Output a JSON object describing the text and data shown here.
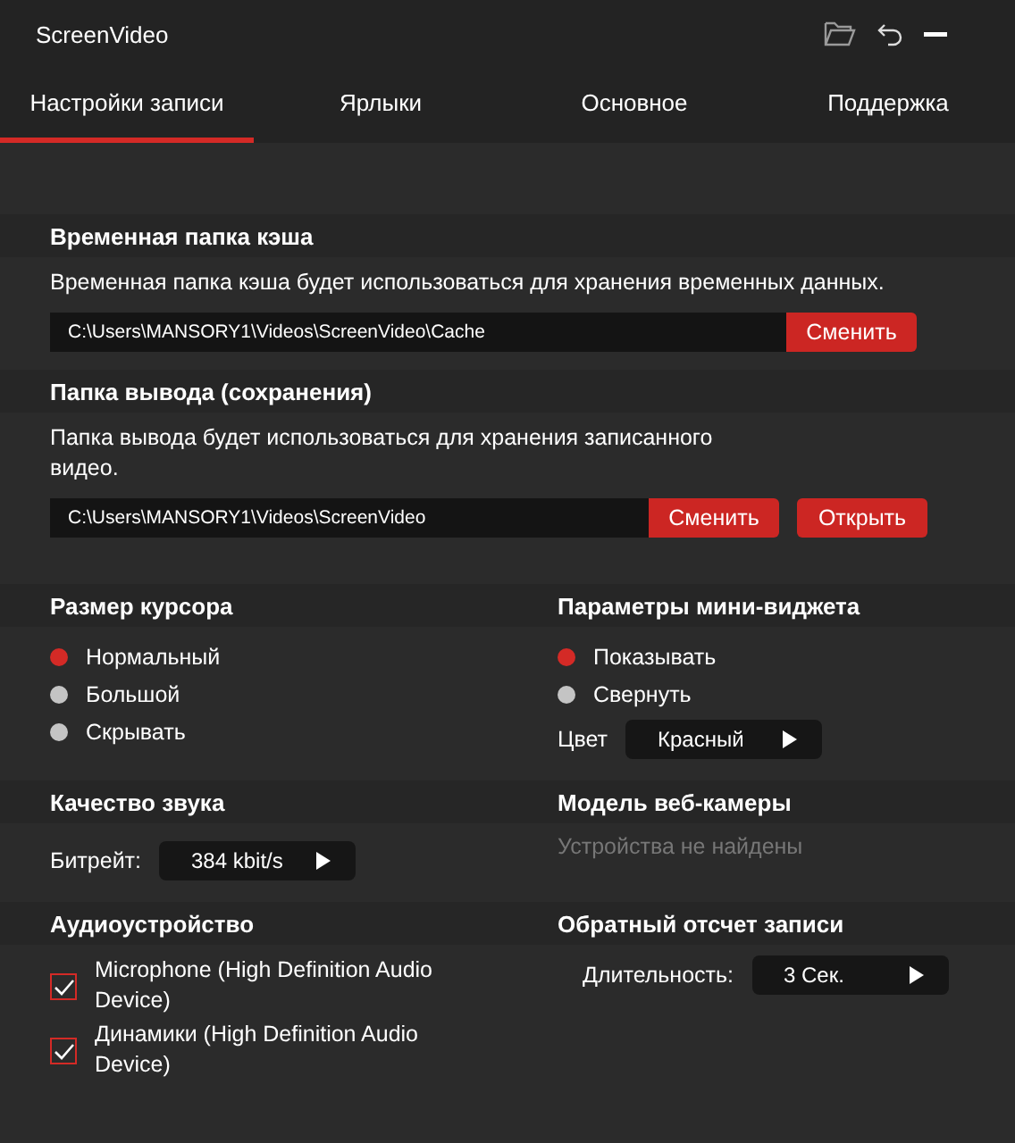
{
  "app_title": "ScreenVideo",
  "tabs": [
    {
      "label": "Настройки записи",
      "selected": true
    },
    {
      "label": "Ярлыки",
      "selected": false
    },
    {
      "label": "Основное",
      "selected": false
    },
    {
      "label": "Поддержка",
      "selected": false
    }
  ],
  "cache": {
    "title": "Временная папка кэша",
    "description": "Временная папка кэша будет использоваться для хранения временных данных.",
    "path": "C:\\Users\\MANSORY1\\Videos\\ScreenVideo\\Cache",
    "change_button": "Сменить"
  },
  "output": {
    "title": "Папка вывода (сохранения)",
    "description": "Папка вывода будет использоваться для хранения записанного видео.",
    "path": "C:\\Users\\MANSORY1\\Videos\\ScreenVideo",
    "change_button": "Сменить",
    "open_button": "Открыть"
  },
  "cursor_size": {
    "title": "Размер курсора",
    "options": [
      {
        "label": "Нормальный",
        "selected": true
      },
      {
        "label": "Большой",
        "selected": false
      },
      {
        "label": "Скрывать",
        "selected": false
      }
    ]
  },
  "mini_widget": {
    "title": "Параметры мини-виджета",
    "options": [
      {
        "label": "Показывать",
        "selected": true
      },
      {
        "label": "Свернуть",
        "selected": false
      }
    ],
    "color_label": "Цвет",
    "color_value": "Красный"
  },
  "audio_quality": {
    "title": "Качество звука",
    "bitrate_label": "Битрейт:",
    "bitrate_value": "384 kbit/s"
  },
  "webcam": {
    "title": "Модель веб-камеры",
    "message": "Устройства не найдены"
  },
  "audio_devices": {
    "title": "Аудиоустройство",
    "devices": [
      {
        "label": "Microphone (High Definition Audio Device)",
        "checked": true
      },
      {
        "label": "Динамики (High Definition Audio Device)",
        "checked": true
      }
    ]
  },
  "countdown": {
    "title": "Обратный отсчет записи",
    "duration_label": "Длительность:",
    "duration_value": "3 Сек."
  }
}
